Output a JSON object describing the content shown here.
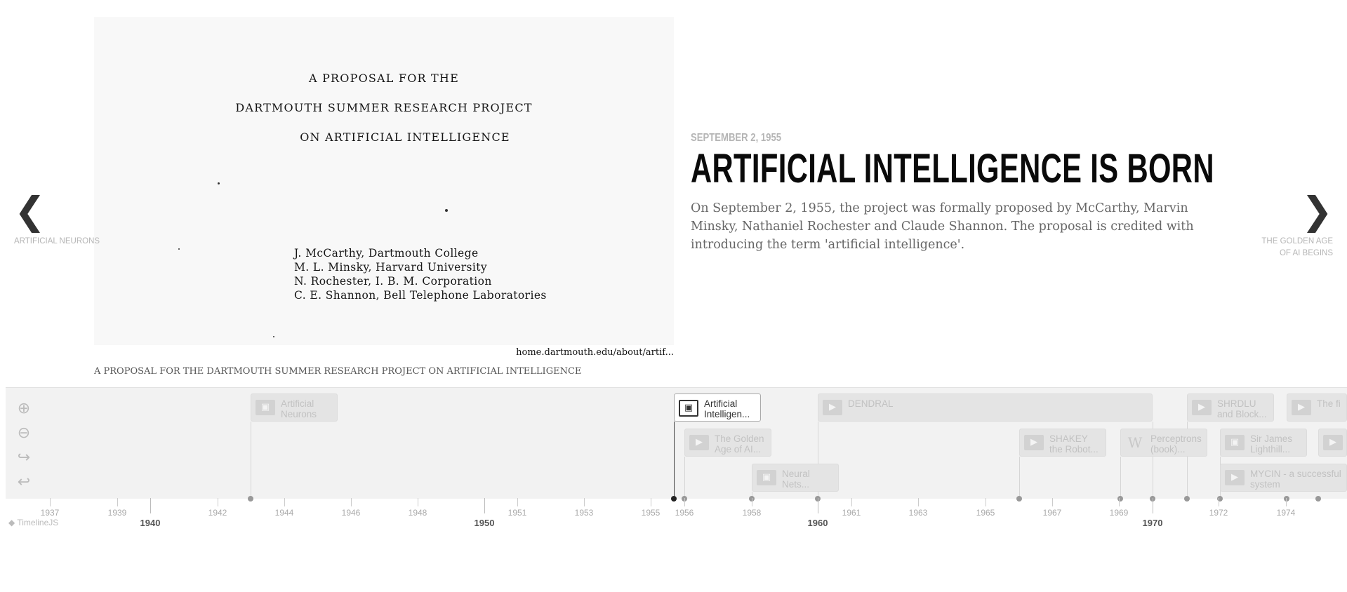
{
  "slide": {
    "date": "SEPTEMBER 2, 1955",
    "headline": "ARTIFICIAL INTELLIGENCE IS BORN",
    "text": "On September 2, 1955, the project was formally proposed by McCarthy, Marvin Minsky, Nathaniel Rochester and Claude Shannon. The proposal is credited with introducing the term 'artificial intelligence'.",
    "media_credit": "home.dartmouth.edu/about/artif...",
    "media_caption": "A PROPOSAL FOR THE DARTMOUTH SUMMER RESEARCH PROJECT ON ARTIFICIAL INTELLIGENCE",
    "document": {
      "title_lines": [
        "A PROPOSAL FOR THE",
        "DARTMOUTH SUMMER RESEARCH PROJECT",
        "ON ARTIFICIAL INTELLIGENCE"
      ],
      "authors": [
        "J. McCarthy, Dartmouth College",
        "M. L. Minsky, Harvard University",
        "N. Rochester, I. B. M. Corporation",
        "C. E. Shannon, Bell Telephone Laboratories"
      ]
    }
  },
  "nav": {
    "prev_label": "ARTIFICIAL NEURONS",
    "next_label": "THE GOLDEN AGE OF AI BEGINS",
    "prev_icon": "chevron-left-icon",
    "next_icon": "chevron-right-icon"
  },
  "tools": [
    "zoom-in-icon",
    "zoom-out-icon",
    "redo-icon",
    "back-to-start-icon"
  ],
  "markers": [
    {
      "label": "Artificial\nNeurons",
      "icon": "image",
      "active": false
    },
    {
      "label": "Artificial\nIntelligen...",
      "icon": "image",
      "active": true
    },
    {
      "label": "The Golden\nAge of AI...",
      "icon": "video",
      "active": false
    },
    {
      "label": "Neural\nNets...",
      "icon": "image",
      "active": false
    },
    {
      "label": "DENDRAL",
      "icon": "video",
      "active": false
    },
    {
      "label": "SHAKEY\nthe Robot...",
      "icon": "video",
      "active": false
    },
    {
      "label": "Perceptrons\n(book)...",
      "icon": "wikipedia",
      "active": false
    },
    {
      "label": "SHRDLU\nand Block...",
      "icon": "video",
      "active": false
    },
    {
      "label": "Sir James\nLighthill...",
      "icon": "image",
      "active": false
    },
    {
      "label": "MYCIN - a successful\nsystem",
      "icon": "video",
      "active": false
    },
    {
      "label": "The fi",
      "icon": "video",
      "active": false
    },
    {
      "label": "",
      "icon": "video",
      "active": false
    }
  ],
  "axis": {
    "minor": [
      "1937",
      "1939",
      "1942",
      "1944",
      "1946",
      "1948",
      "1951",
      "1953",
      "1955",
      "1956",
      "1958",
      "1961",
      "1963",
      "1965",
      "1967",
      "1969",
      "1972",
      "1974"
    ],
    "major": [
      "1940",
      "1950",
      "1960",
      "1970"
    ]
  },
  "brand": "TimelineJS"
}
